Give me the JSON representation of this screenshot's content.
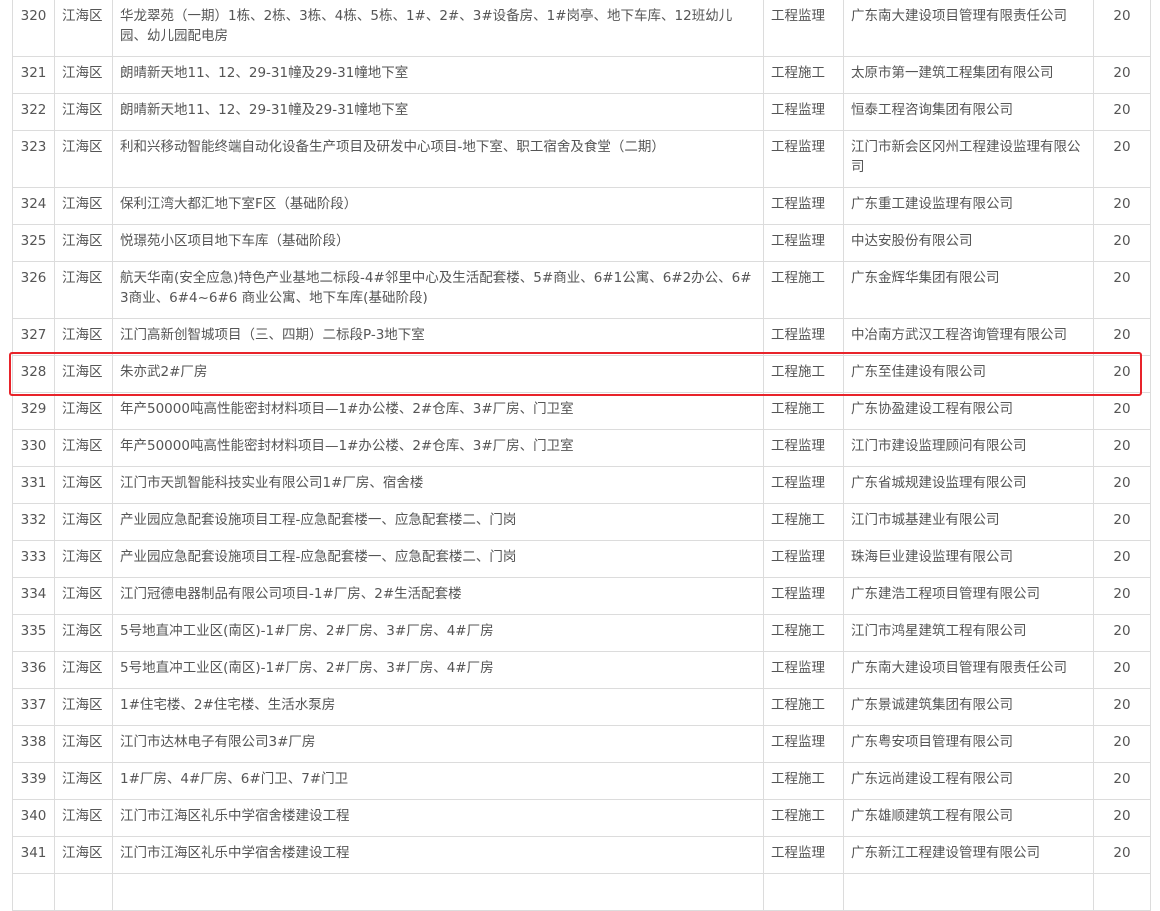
{
  "table": {
    "rows": [
      {
        "no": "320",
        "district": "江海区",
        "project": "华龙翠苑（一期）1栋、2栋、3栋、4栋、5栋、1#、2#、3#设备房、1#岗亭、地下车库、12班幼儿园、幼儿园配电房",
        "type": "工程监理",
        "company": "广东南大建设项目管理有限责任公司",
        "score": "20",
        "tall": true
      },
      {
        "no": "321",
        "district": "江海区",
        "project": "朗晴新天地11、12、29-31幢及29-31幢地下室",
        "type": "工程施工",
        "company": "太原市第一建筑工程集团有限公司",
        "score": "20"
      },
      {
        "no": "322",
        "district": "江海区",
        "project": "朗晴新天地11、12、29-31幢及29-31幢地下室",
        "type": "工程监理",
        "company": "恒泰工程咨询集团有限公司",
        "score": "20"
      },
      {
        "no": "323",
        "district": "江海区",
        "project": "利和兴移动智能终端自动化设备生产项目及研发中心项目-地下室、职工宿舍及食堂（二期）",
        "type": "工程监理",
        "company": "江门市新会区冈州工程建设监理有限公司",
        "score": "20",
        "tall": true
      },
      {
        "no": "324",
        "district": "江海区",
        "project": "保利江湾大都汇地下室F区（基础阶段）",
        "type": "工程监理",
        "company": "广东重工建设监理有限公司",
        "score": "20"
      },
      {
        "no": "325",
        "district": "江海区",
        "project": "悦璟苑小区项目地下车库（基础阶段）",
        "type": "工程监理",
        "company": "中达安股份有限公司",
        "score": "20"
      },
      {
        "no": "326",
        "district": "江海区",
        "project": "航天华南(安全应急)特色产业基地二标段-4#邻里中心及生活配套楼、5#商业、6#1公寓、6#2办公、6#3商业、6#4~6#6 商业公寓、地下车库(基础阶段)",
        "type": "工程施工",
        "company": "广东金辉华集团有限公司",
        "score": "20",
        "tall": true
      },
      {
        "no": "327",
        "district": "江海区",
        "project": "江门高新创智城项目（三、四期）二标段P-3地下室",
        "type": "工程监理",
        "company": "中冶南方武汉工程咨询管理有限公司",
        "score": "20"
      },
      {
        "no": "328",
        "district": "江海区",
        "project": "朱亦武2#厂房",
        "type": "工程施工",
        "company": "广东至佳建设有限公司",
        "score": "20",
        "highlighted": true
      },
      {
        "no": "329",
        "district": "江海区",
        "project": "年产50000吨高性能密封材料项目—1#办公楼、2#仓库、3#厂房、门卫室",
        "type": "工程施工",
        "company": "广东协盈建设工程有限公司",
        "score": "20"
      },
      {
        "no": "330",
        "district": "江海区",
        "project": "年产50000吨高性能密封材料项目—1#办公楼、2#仓库、3#厂房、门卫室",
        "type": "工程监理",
        "company": "江门市建设监理顾问有限公司",
        "score": "20"
      },
      {
        "no": "331",
        "district": "江海区",
        "project": "江门市天凯智能科技实业有限公司1#厂房、宿舍楼",
        "type": "工程监理",
        "company": "广东省城规建设监理有限公司",
        "score": "20"
      },
      {
        "no": "332",
        "district": "江海区",
        "project": "产业园应急配套设施项目工程-应急配套楼一、应急配套楼二、门岗",
        "type": "工程施工",
        "company": "江门市城基建业有限公司",
        "score": "20"
      },
      {
        "no": "333",
        "district": "江海区",
        "project": "产业园应急配套设施项目工程-应急配套楼一、应急配套楼二、门岗",
        "type": "工程监理",
        "company": "珠海巨业建设监理有限公司",
        "score": "20"
      },
      {
        "no": "334",
        "district": "江海区",
        "project": "江门冠德电器制品有限公司项目-1#厂房、2#生活配套楼",
        "type": "工程监理",
        "company": "广东建浩工程项目管理有限公司",
        "score": "20"
      },
      {
        "no": "335",
        "district": "江海区",
        "project": "5号地直冲工业区(南区)-1#厂房、2#厂房、3#厂房、4#厂房",
        "type": "工程施工",
        "company": "江门市鸿星建筑工程有限公司",
        "score": "20"
      },
      {
        "no": "336",
        "district": "江海区",
        "project": "5号地直冲工业区(南区)-1#厂房、2#厂房、3#厂房、4#厂房",
        "type": "工程监理",
        "company": "广东南大建设项目管理有限责任公司",
        "score": "20"
      },
      {
        "no": "337",
        "district": "江海区",
        "project": "1#住宅楼、2#住宅楼、生活水泵房",
        "type": "工程施工",
        "company": "广东景诚建筑集团有限公司",
        "score": "20"
      },
      {
        "no": "338",
        "district": "江海区",
        "project": "江门市达林电子有限公司3#厂房",
        "type": "工程监理",
        "company": "广东粤安项目管理有限公司",
        "score": "20"
      },
      {
        "no": "339",
        "district": "江海区",
        "project": "1#厂房、4#厂房、6#门卫、7#门卫",
        "type": "工程施工",
        "company": "广东远尚建设工程有限公司",
        "score": "20"
      },
      {
        "no": "340",
        "district": "江海区",
        "project": "江门市江海区礼乐中学宿舍楼建设工程",
        "type": "工程施工",
        "company": "广东雄顺建筑工程有限公司",
        "score": "20"
      },
      {
        "no": "341",
        "district": "江海区",
        "project": "江门市江海区礼乐中学宿舍楼建设工程",
        "type": "工程监理",
        "company": "广东新江工程建设管理有限公司",
        "score": "20"
      },
      {
        "no": "",
        "district": "",
        "project": "",
        "type": "",
        "company": "",
        "score": ""
      }
    ]
  },
  "colors": {
    "border": "#dcdcdc",
    "text": "#555555",
    "highlight": "#e8232a"
  }
}
